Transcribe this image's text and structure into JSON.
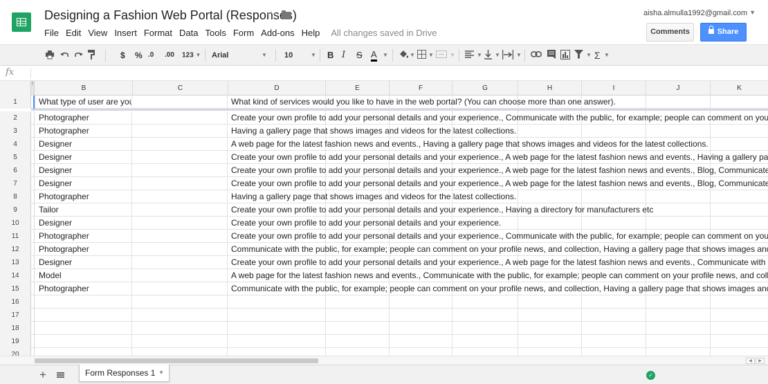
{
  "colors": {
    "sheets_green": "#1fa463",
    "share_blue": "#4d90fe",
    "selection_blue": "#4d90fe"
  },
  "header": {
    "title": "Designing a Fashion Web Portal (Responses)",
    "star_icon": "star-outline-icon",
    "folder_icon": "folder-icon",
    "account_email": "aisha.almulla1992@gmail.com",
    "comments_label": "Comments",
    "share_label": "Share"
  },
  "menubar": {
    "items": [
      "File",
      "Edit",
      "View",
      "Insert",
      "Format",
      "Data",
      "Tools",
      "Form",
      "Add-ons",
      "Help"
    ],
    "save_status": "All changes saved in Drive"
  },
  "toolbar": {
    "currency": "$",
    "percent": "%",
    "decrease_decimals": ".0",
    "increase_decimals": ".00",
    "more_formats": "123",
    "font": "Arial",
    "font_size": "10",
    "bold": "B",
    "italic": "I",
    "strike": "S",
    "text_color": "A",
    "sum": "Σ"
  },
  "formula_bar": {
    "fx_label": "fx",
    "value": ""
  },
  "columns": [
    "B",
    "C",
    "D",
    "E",
    "F",
    "G",
    "H",
    "I",
    "J",
    "K"
  ],
  "frozen_col_label": "!",
  "rows": [
    {
      "num": "1",
      "b": "What type of user are you?",
      "d": "What kind of services would you like to have in the web portal? (You can choose more than one answer)."
    },
    {
      "num": "2",
      "b": "Photographer",
      "d": "Create your own profile to add your personal details and your experience., Communicate with the public, for example; people can comment on you"
    },
    {
      "num": "3",
      "b": "Photographer",
      "d": "Having a gallery page that shows images and videos for the latest collections."
    },
    {
      "num": "4",
      "b": "Designer",
      "d": "A web page for the latest fashion news and events., Having a gallery page that shows images and videos for the latest collections."
    },
    {
      "num": "5",
      "b": "Designer",
      "d": "Create your own profile to add your personal details and your experience., A web page for the latest fashion news and events., Having a gallery pa"
    },
    {
      "num": "6",
      "b": "Designer",
      "d": "Create your own profile to add your personal details and your experience., A web page for the latest fashion news and events., Blog, Communicate"
    },
    {
      "num": "7",
      "b": "Designer",
      "d": "Create your own profile to add your personal details and your experience., A web page for the latest fashion news and events., Blog, Communicate"
    },
    {
      "num": "8",
      "b": "Photographer",
      "d": "Having a gallery page that shows images and videos for the latest collections."
    },
    {
      "num": "9",
      "b": "Tailor",
      "d": "Create your own profile to add your personal details and your experience., Having a directory for manufacturers etc"
    },
    {
      "num": "10",
      "b": "Designer",
      "d": "Create your own profile to add your personal details and your experience."
    },
    {
      "num": "11",
      "b": "Photographer",
      "d": "Create your own profile to add your personal details and your experience., Communicate with the public, for example; people can comment on you"
    },
    {
      "num": "12",
      "b": "Photographer",
      "d": "Communicate with the public, for example; people can comment on your profile news, and collection, Having a gallery page that shows images and"
    },
    {
      "num": "13",
      "b": "Designer",
      "d": "Create your own profile to add your personal details and your experience., A web page for the latest fashion news and events., Communicate with"
    },
    {
      "num": "14",
      "b": "Model",
      "d": "A web page for the latest fashion news and events., Communicate with the public, for example; people can comment on your profile news, and coll"
    },
    {
      "num": "15",
      "b": "Photographer",
      "d": "Communicate with the public, for example; people can comment on your profile news, and collection, Having a gallery page that shows images and"
    },
    {
      "num": "16",
      "b": "",
      "d": ""
    },
    {
      "num": "17",
      "b": "",
      "d": ""
    },
    {
      "num": "18",
      "b": "",
      "d": ""
    },
    {
      "num": "19",
      "b": "",
      "d": ""
    },
    {
      "num": "20",
      "b": "",
      "d": ""
    }
  ],
  "sheet_bar": {
    "add_label": "+",
    "active_tab": "Form Responses 1",
    "sync_icon": "check-circle-icon"
  }
}
